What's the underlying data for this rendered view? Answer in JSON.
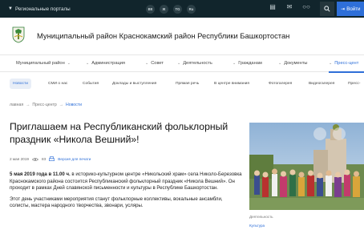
{
  "topbar": {
    "region_label": "Региональные порталы",
    "socials": [
      "ВК",
      "Ж",
      "TG",
      "Ru"
    ],
    "login_label": "Войти"
  },
  "header": {
    "site_title": "Муниципальный район Краснокамский район Республики Башкортостан"
  },
  "main_nav": {
    "items": [
      "Муниципальный район",
      "Администрация",
      "Совет",
      "Деятельность",
      "Гражданам",
      "Документы",
      "Пресс-цент"
    ]
  },
  "sub_nav": {
    "items": [
      "Новости",
      "СМИ о нас",
      "События",
      "Доклады и выступления",
      "Прямая речь",
      "В центре внимания",
      "Фотогалерея",
      "Видеогалерея",
      "Пресс-"
    ]
  },
  "breadcrumbs": [
    "лавная",
    "Пресс-центр",
    "Новости"
  ],
  "article": {
    "title": "Приглашаем на Республиканский фольклорный праздник «Никола Вешний»!",
    "date": "2 мая 2019",
    "views": "83",
    "print_label": "Версия для печати",
    "paragraph1_bold": "5 мая 2019 года в 11.00 ч.",
    "paragraph1_rest": " в историко-культурном центре «Никольский храм» села Николо-Березовка Краснокамского района состоится Республиканский фольклорный праздник «Никола Вешний». Он проходит в рамках Дней славянской письменности и культуры в Республике Башкортостан.",
    "paragraph2": "Этот день участниками мероприятия станут фольклорные коллективы, вокальные ансамбли, солисты, мастера народного творчества, звонари, усляры."
  },
  "aside": {
    "caption_label": "Деятельность",
    "caption_tag": "Культура"
  },
  "colors": {
    "topbar": "#11252c",
    "accent": "#2e6fd8"
  }
}
